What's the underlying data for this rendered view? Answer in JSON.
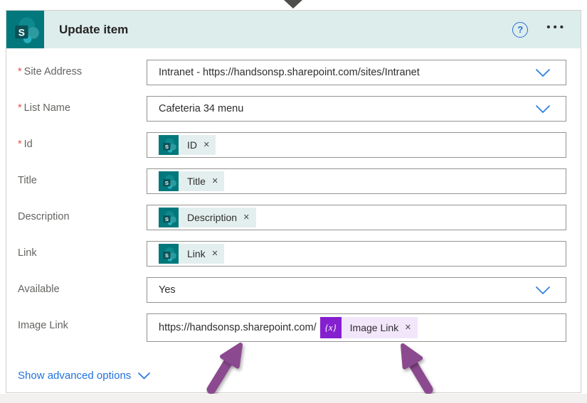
{
  "connector": {
    "icon": "flow-connector-down-arrow"
  },
  "header": {
    "title": "Update item",
    "connector_icon": "sharepoint-icon",
    "help_label": "?",
    "more_label": "•••"
  },
  "fields": [
    {
      "id": "site-address",
      "label": "Site Address",
      "required": true,
      "required_marker": "*",
      "type": "dropdown",
      "value": "Intranet - https://handsonsp.sharepoint.com/sites/Intranet"
    },
    {
      "id": "list-name",
      "label": "List Name",
      "required": true,
      "required_marker": "*",
      "type": "dropdown",
      "value": "Cafeteria 34 menu"
    },
    {
      "id": "id",
      "label": "Id",
      "required": true,
      "required_marker": "*",
      "type": "token",
      "token": {
        "icon": "sharepoint-icon",
        "label": "ID",
        "remove": "×"
      }
    },
    {
      "id": "title",
      "label": "Title",
      "required": false,
      "type": "token",
      "token": {
        "icon": "sharepoint-icon",
        "label": "Title",
        "remove": "×"
      }
    },
    {
      "id": "description",
      "label": "Description",
      "required": false,
      "type": "token",
      "token": {
        "icon": "sharepoint-icon",
        "label": "Description",
        "remove": "×"
      }
    },
    {
      "id": "link",
      "label": "Link",
      "required": false,
      "type": "token",
      "token": {
        "icon": "sharepoint-icon",
        "label": "Link",
        "remove": "×"
      }
    },
    {
      "id": "available",
      "label": "Available",
      "required": false,
      "type": "dropdown",
      "value": "Yes"
    },
    {
      "id": "image-link",
      "label": "Image Link",
      "required": false,
      "type": "text-with-token",
      "value": "https://handsonsp.sharepoint.com/",
      "token": {
        "icon": "expression-icon",
        "glyph": "{x}",
        "label": "Image Link",
        "remove": "×"
      }
    }
  ],
  "footer": {
    "advanced_label": "Show advanced options"
  },
  "colors": {
    "sharepoint_teal": "#03787c",
    "header_tint": "#ddedec",
    "token_tint": "#e3efee",
    "expression_purple": "#8520cf",
    "expression_tint": "#f2e6fb",
    "link_blue": "#2271e0",
    "required_red": "#e8504a",
    "annotation_plum": "#8b4a8f",
    "connector_gray": "#4e4d4b"
  }
}
